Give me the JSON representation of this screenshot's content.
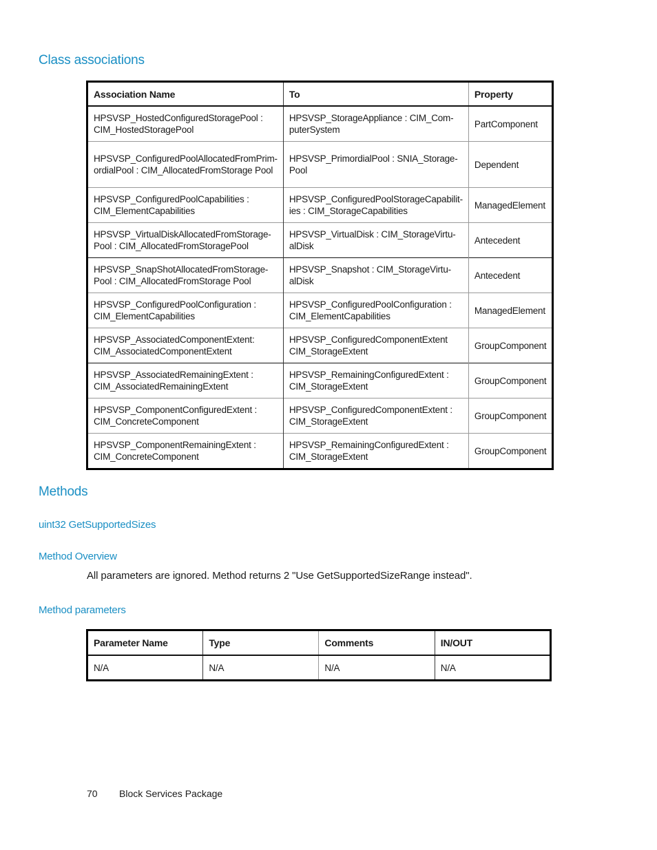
{
  "sections": {
    "class_associations": "Class associations",
    "methods": "Methods",
    "method_name": "uint32 GetSupportedSizes",
    "method_overview": "Method Overview",
    "method_parameters": "Method parameters"
  },
  "overview_text": "All parameters are ignored. Method returns 2 \"Use GetSupportedSizeRange instead\".",
  "associations_table": {
    "headers": [
      "Association Name",
      "To",
      "Property"
    ],
    "rows": [
      [
        "HPSVSP_HostedConfiguredStoragePool : CIM_HostedStoragePool",
        "HPSVSP_StorageAppliance : CIM_Com-puterSystem",
        "PartComponent"
      ],
      [
        "HPSVSP_ConfiguredPoolAllocatedFromPrim-ordialPool : CIM_AllocatedFromStorage Pool",
        "HPSVSP_PrimordialPool : SNIA_Storage-Pool",
        "Dependent"
      ],
      [
        "HPSVSP_ConfiguredPoolCapabilities : CIM_ElementCapabilities",
        "HPSVSP_ConfiguredPoolStorageCapabilit-ies : CIM_StorageCapabilities",
        "ManagedElement"
      ],
      [
        "HPSVSP_VirtualDiskAllocatedFromStorage-Pool : CIM_AllocatedFromStoragePool",
        "HPSVSP_VirtualDisk : CIM_StorageVirtu-alDisk",
        "Antecedent"
      ],
      [
        "HPSVSP_SnapShotAllocatedFromStorage-Pool : CIM_AllocatedFromStorage Pool",
        "HPSVSP_Snapshot : CIM_StorageVirtu-alDisk",
        "Antecedent"
      ],
      [
        "HPSVSP_ConfiguredPoolConfiguration : CIM_ElementCapabilities",
        "HPSVSP_ConfiguredPoolConfiguration : CIM_ElementCapabilities",
        "ManagedElement"
      ],
      [
        "HPSVSP_AssociatedComponentExtent: CIM_AssociatedComponentExtent",
        "HPSVSP_ConfiguredComponentExtent CIM_StorageExtent",
        "GroupComponent"
      ],
      [
        "HPSVSP_AssociatedRemainingExtent : CIM_AssociatedRemainingExtent",
        "HPSVSP_RemainingConfiguredExtent : CIM_StorageExtent",
        "GroupComponent"
      ],
      [
        "HPSVSP_ComponentConfiguredExtent : CIM_ConcreteComponent",
        "HPSVSP_ConfiguredComponentExtent : CIM_StorageExtent",
        "GroupComponent"
      ],
      [
        "HPSVSP_ComponentRemainingExtent : CIM_ConcreteComponent",
        "HPSVSP_RemainingConfiguredExtent : CIM_StorageExtent",
        "GroupComponent"
      ]
    ]
  },
  "parameters_table": {
    "headers": [
      "Parameter Name",
      "Type",
      "Comments",
      "IN/OUT"
    ],
    "rows": [
      [
        "N/A",
        "N/A",
        "N/A",
        "N/A"
      ]
    ]
  },
  "footer": {
    "page_number": "70",
    "title": "Block Services Package"
  }
}
